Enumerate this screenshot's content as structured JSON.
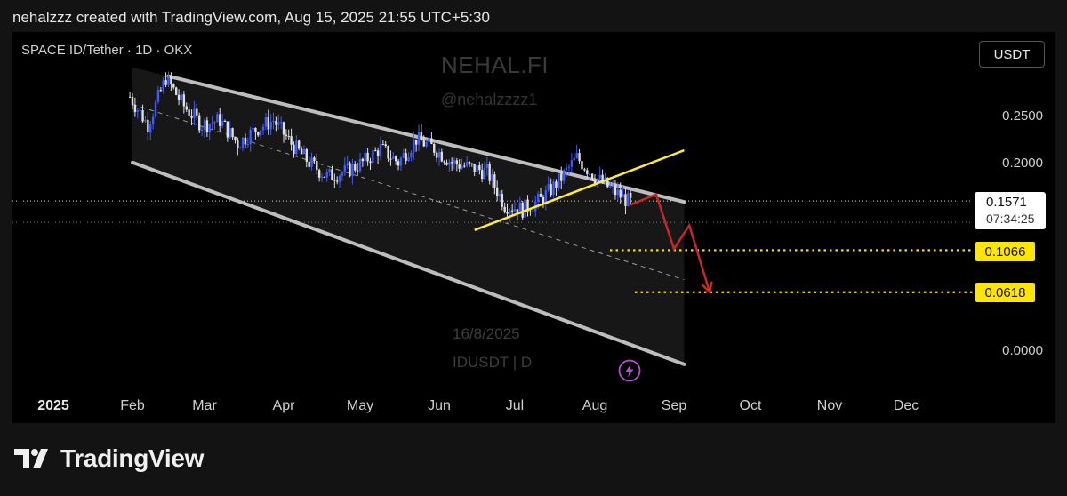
{
  "caption": "nehalzzz created with TradingView.com, Aug 15, 2025 21:55 UTC+5:30",
  "symbol_line": "SPACE ID/Tether · 1D · OKX",
  "currency": "USDT",
  "watermark": {
    "title": "NEHAL.FI",
    "handle": "@nehalzzzz1",
    "date": "16/8/2025",
    "ticker": "IDUSDT | D"
  },
  "price_tag": {
    "value": "0.1571",
    "countdown": "07:34:25"
  },
  "targets": [
    {
      "label": "0.1066"
    },
    {
      "label": "0.0618"
    }
  ],
  "logo_text": "TradingView",
  "icons": {
    "bolt": "lightning-bolt-icon",
    "logo": "tradingview-logo-icon"
  },
  "colors": {
    "up": "#3d5afe",
    "down": "#e0e0e0",
    "channel": "#bdbdbd",
    "support": "#ffeb3b",
    "forecast": "#c62828",
    "target": "#ffe600",
    "bolt": "#b44fd6"
  },
  "chart_data": {
    "type": "candlestick",
    "ylim": [
      0.0,
      0.3
    ],
    "y_ticks": [
      {
        "value": 0.25,
        "label": "0.2500"
      },
      {
        "value": 0.2,
        "label": "0.2000"
      },
      {
        "value": 0.0,
        "label": "0.0000"
      }
    ],
    "x_ticks": [
      "2025",
      "Feb",
      "Mar",
      "Apr",
      "May",
      "Jun",
      "Jul",
      "Aug",
      "Sep",
      "Oct",
      "Nov",
      "Dec"
    ],
    "current_price": 0.1571,
    "target_levels": [
      0.1066,
      0.0618
    ],
    "channel": {
      "upper": [
        [
          "2025-02-15",
          0.292
        ],
        [
          "2025-09-05",
          0.158
        ]
      ],
      "lower": [
        [
          "2025-02-01",
          0.2
        ],
        [
          "2025-09-05",
          -0.015
        ]
      ],
      "mid": [
        [
          "2025-02-01",
          0.262
        ],
        [
          "2025-09-05",
          0.075
        ]
      ]
    },
    "support_line": [
      [
        "2025-06-15",
        0.128
      ],
      [
        "2025-09-05",
        0.213
      ]
    ],
    "forecast_path": [
      [
        "2025-08-15",
        0.155
      ],
      [
        "2025-08-25",
        0.166
      ],
      [
        "2025-09-01",
        0.108
      ],
      [
        "2025-09-07",
        0.133
      ],
      [
        "2025-09-15",
        0.062
      ]
    ],
    "price_series_weekly_close": [
      [
        "2025-01-31",
        0.27
      ],
      [
        "2025-02-07",
        0.24
      ],
      [
        "2025-02-14",
        0.29
      ],
      [
        "2025-02-21",
        0.26
      ],
      [
        "2025-02-28",
        0.24
      ],
      [
        "2025-03-07",
        0.245
      ],
      [
        "2025-03-14",
        0.22
      ],
      [
        "2025-03-21",
        0.235
      ],
      [
        "2025-03-28",
        0.245
      ],
      [
        "2025-04-04",
        0.22
      ],
      [
        "2025-04-11",
        0.2
      ],
      [
        "2025-04-18",
        0.185
      ],
      [
        "2025-04-25",
        0.19
      ],
      [
        "2025-05-02",
        0.2
      ],
      [
        "2025-05-09",
        0.215
      ],
      [
        "2025-05-16",
        0.2
      ],
      [
        "2025-05-23",
        0.225
      ],
      [
        "2025-05-30",
        0.215
      ],
      [
        "2025-06-06",
        0.2
      ],
      [
        "2025-06-13",
        0.195
      ],
      [
        "2025-06-20",
        0.19
      ],
      [
        "2025-06-27",
        0.155
      ],
      [
        "2025-07-04",
        0.15
      ],
      [
        "2025-07-11",
        0.16
      ],
      [
        "2025-07-18",
        0.18
      ],
      [
        "2025-07-25",
        0.205
      ],
      [
        "2025-08-01",
        0.185
      ],
      [
        "2025-08-08",
        0.17
      ],
      [
        "2025-08-15",
        0.1571
      ]
    ]
  }
}
